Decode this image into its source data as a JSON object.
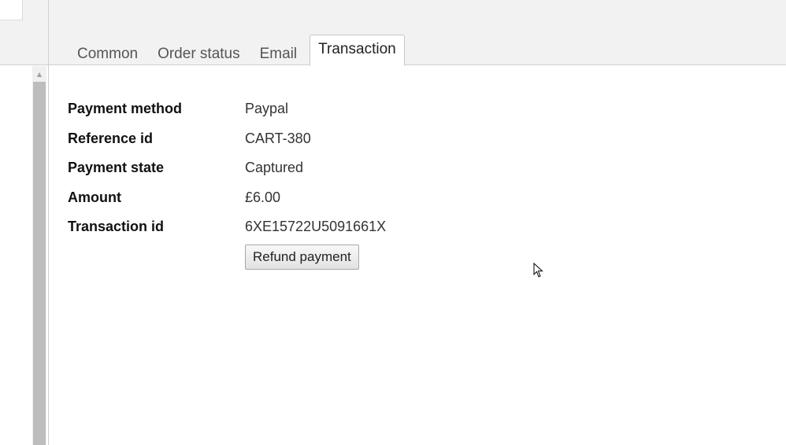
{
  "tabs": [
    {
      "label": "Common",
      "active": false
    },
    {
      "label": "Order status",
      "active": false
    },
    {
      "label": "Email",
      "active": false
    },
    {
      "label": "Transaction",
      "active": true
    }
  ],
  "transaction": {
    "rows": [
      {
        "label": "Payment method",
        "value": "Paypal"
      },
      {
        "label": "Reference id",
        "value": "CART-380"
      },
      {
        "label": "Payment state",
        "value": "Captured"
      },
      {
        "label": "Amount",
        "value": "£6.00"
      },
      {
        "label": "Transaction id",
        "value": "6XE15722U5091661X"
      }
    ],
    "refund_button_label": "Refund payment"
  },
  "icons": {
    "scroll_up": "triangle-up",
    "cursor": "mouse-pointer"
  }
}
